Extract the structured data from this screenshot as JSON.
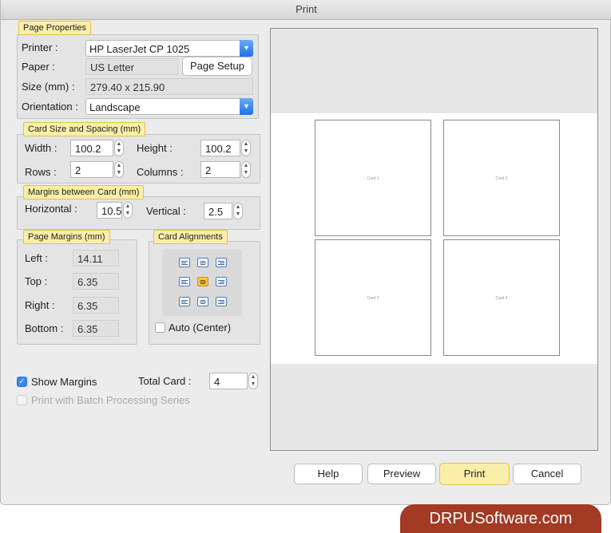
{
  "window": {
    "title": "Print"
  },
  "page_properties": {
    "heading": "Page Properties",
    "printer_label": "Printer :",
    "printer_value": "HP LaserJet CP 1025",
    "paper_label": "Paper :",
    "paper_value": "US Letter",
    "page_setup_button": "Page Setup",
    "size_label": "Size (mm) :",
    "size_value": "279.40 x 215.90",
    "orientation_label": "Orientation :",
    "orientation_value": "Landscape"
  },
  "card_size": {
    "heading": "Card Size and Spacing (mm)",
    "width_label": "Width :",
    "width_value": "100.2",
    "height_label": "Height :",
    "height_value": "100.2",
    "rows_label": "Rows :",
    "rows_value": "2",
    "columns_label": "Columns :",
    "columns_value": "2"
  },
  "margins_between": {
    "heading": "Margins between Card (mm)",
    "horizontal_label": "Horizontal :",
    "horizontal_value": "10.5",
    "vertical_label": "Vertical :",
    "vertical_value": "2.5"
  },
  "page_margins": {
    "heading": "Page Margins (mm)",
    "left_label": "Left :",
    "left_value": "14.11",
    "top_label": "Top :",
    "top_value": "6.35",
    "right_label": "Right :",
    "right_value": "6.35",
    "bottom_label": "Bottom :",
    "bottom_value": "6.35"
  },
  "card_alignments": {
    "heading": "Card Alignments",
    "selected": "middle-center",
    "auto_center_label": "Auto (Center)",
    "auto_center_checked": false
  },
  "options": {
    "show_margins_label": "Show Margins",
    "show_margins_checked": true,
    "total_card_label": "Total Card :",
    "total_card_value": "4",
    "batch_label": "Print with Batch Processing Series",
    "batch_checked": false
  },
  "preview": {
    "cards": [
      "Card 1",
      "Card 2",
      "Card 3",
      "Card 4"
    ]
  },
  "buttons": {
    "help": "Help",
    "preview": "Preview",
    "print": "Print",
    "cancel": "Cancel"
  },
  "branding": {
    "logo_text": "DRPUSoftware.com"
  },
  "colors": {
    "accent_blue": "#1a72ec",
    "highlight_yellow": "#fbeeaa",
    "logo_red": "#a23a24"
  }
}
